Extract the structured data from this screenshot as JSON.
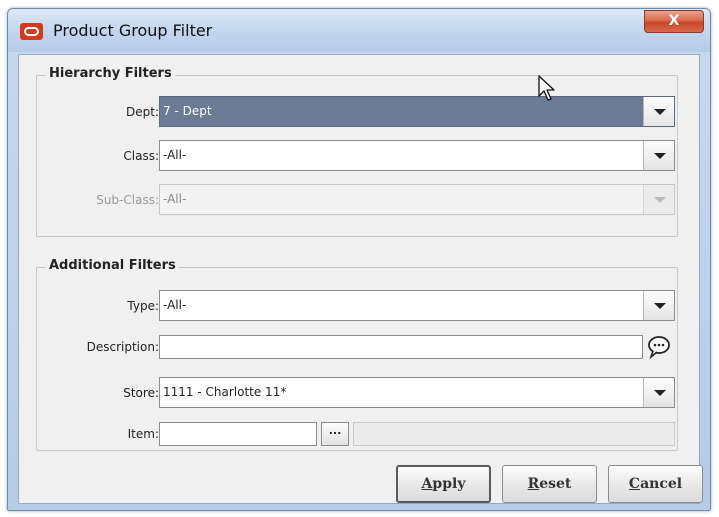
{
  "window": {
    "title": "Product Group Filter",
    "close_label": "X"
  },
  "hierarchy": {
    "legend": "Hierarchy Filters",
    "dept": {
      "label": "Dept:",
      "value": "7 - Dept"
    },
    "class": {
      "label": "Class:",
      "value": "-All-"
    },
    "subclass": {
      "label": "Sub-Class:",
      "value": "-All-",
      "disabled": true
    }
  },
  "additional": {
    "legend": "Additional Filters",
    "type": {
      "label": "Type:",
      "value": "-All-"
    },
    "description": {
      "label": "Description:",
      "value": ""
    },
    "store": {
      "label": "Store:",
      "value": "1111 - Charlotte 11*"
    },
    "item": {
      "label": "Item:",
      "value": "",
      "browse_label": "..."
    }
  },
  "buttons": {
    "apply": {
      "mnemonic": "A",
      "rest": "pply"
    },
    "reset": {
      "mnemonic": "R",
      "rest": "eset"
    },
    "cancel": {
      "mnemonic": "C",
      "rest": "ancel"
    }
  },
  "icons": {
    "app": "oracle-logo-icon",
    "description_action": "comment-bubble-icon",
    "cursor": "mouse-pointer-icon"
  },
  "colors": {
    "selected_combo": "#6b7a95",
    "close_button": "#c8452a",
    "app_icon": "#d63a1c"
  }
}
